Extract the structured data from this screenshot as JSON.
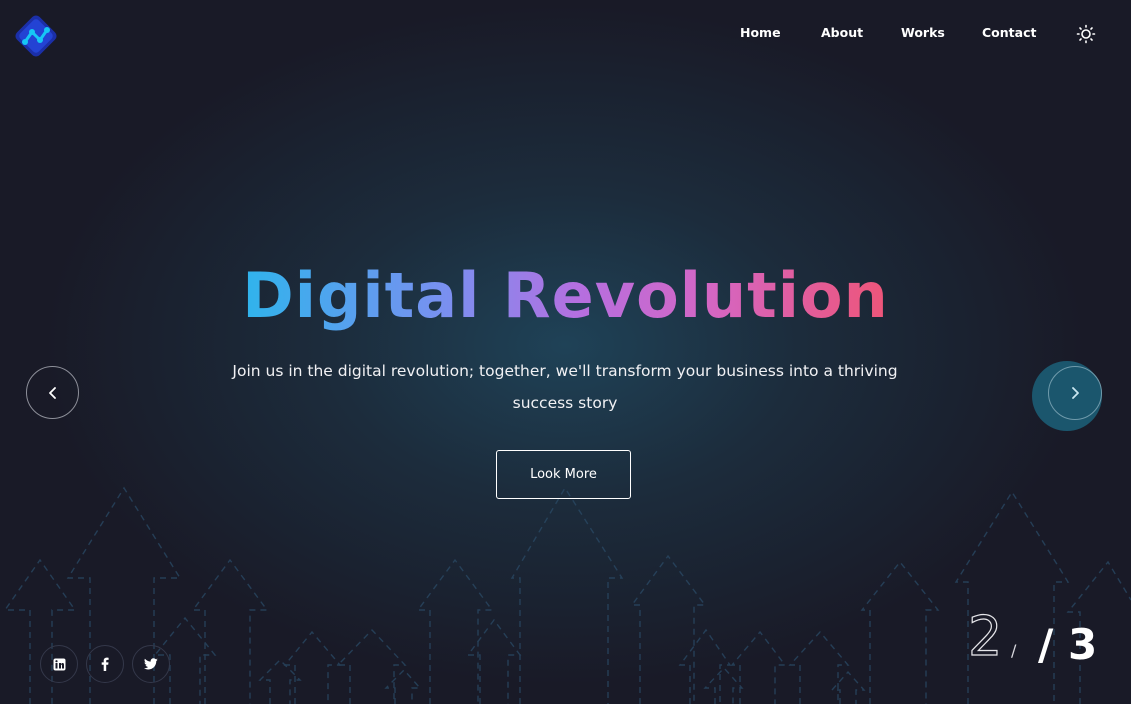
{
  "nav": {
    "home": "Home",
    "about": "About",
    "works": "Works",
    "contact": "Contact",
    "theme_toggle_icon": "sun-icon"
  },
  "logo": {
    "icon": "logo-icon",
    "colors": [
      "#1b2fa8",
      "#2a5cff",
      "#16c6f5"
    ]
  },
  "hero": {
    "title": "Digital Revolution",
    "subtitle": "Join us in the digital revolution; together, we'll transform your business into a thriving success story",
    "cta_label": "Look More"
  },
  "slider": {
    "prev_icon": "chevron-left-icon",
    "next_icon": "chevron-right-icon",
    "current": "2",
    "separator": "/",
    "total": "/ 3"
  },
  "social": [
    {
      "name": "linkedin",
      "icon": "linkedin-icon"
    },
    {
      "name": "facebook",
      "icon": "facebook-icon"
    },
    {
      "name": "twitter",
      "icon": "twitter-icon"
    }
  ],
  "colors": {
    "background": "#191a27",
    "glow": "#1f4257",
    "gradient": [
      "#2fb4ec",
      "#7b8ff0",
      "#b56fe0",
      "#d466c4",
      "#ee5578"
    ],
    "accent": "#1b5a71"
  }
}
